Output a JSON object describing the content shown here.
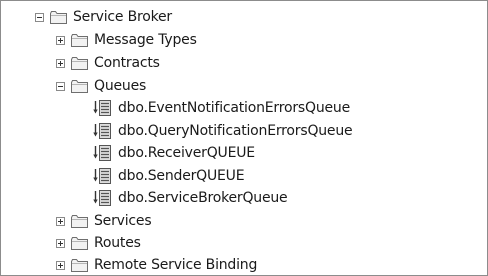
{
  "tree": {
    "root": {
      "label": "Service Broker",
      "icon": "folder-icon",
      "expanded": true
    },
    "children": [
      {
        "label": "Message Types",
        "icon": "folder-icon",
        "expanded": false
      },
      {
        "label": "Contracts",
        "icon": "folder-icon",
        "expanded": false
      },
      {
        "label": "Queues",
        "icon": "folder-icon",
        "expanded": true,
        "items": [
          {
            "label": "dbo.EventNotificationErrorsQueue",
            "icon": "queue-icon"
          },
          {
            "label": "dbo.QueryNotificationErrorsQueue",
            "icon": "queue-icon"
          },
          {
            "label": "dbo.ReceiverQUEUE",
            "icon": "queue-icon"
          },
          {
            "label": "dbo.SenderQUEUE",
            "icon": "queue-icon"
          },
          {
            "label": "dbo.ServiceBrokerQueue",
            "icon": "queue-icon"
          }
        ]
      },
      {
        "label": "Services",
        "icon": "folder-icon",
        "expanded": false
      },
      {
        "label": "Routes",
        "icon": "folder-icon",
        "expanded": false
      },
      {
        "label": "Remote Service Binding",
        "icon": "folder-icon",
        "expanded": false
      }
    ]
  }
}
